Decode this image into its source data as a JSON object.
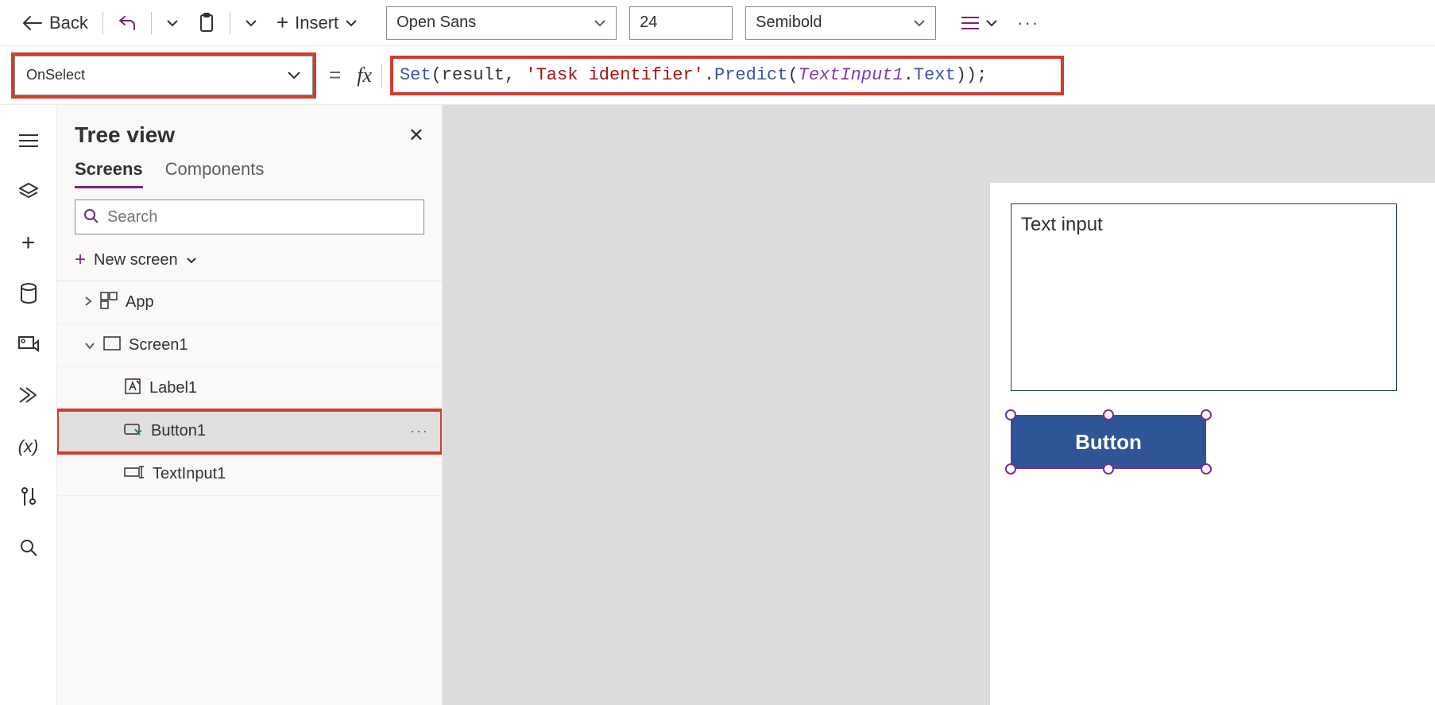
{
  "toolbar": {
    "back_label": "Back",
    "insert_label": "Insert",
    "font": "Open Sans",
    "font_size": "24",
    "font_weight": "Semibold"
  },
  "formula": {
    "property": "OnSelect",
    "tokens": {
      "set": "Set",
      "open_args": "(result, ",
      "str": "'Task identifier'",
      "dot1": ".",
      "predict": "Predict",
      "open2": "(",
      "ident": "TextInput1",
      "dot2": ".",
      "text_prop": "Text",
      "close": "));"
    }
  },
  "tree": {
    "title": "Tree view",
    "tabs": {
      "screens": "Screens",
      "components": "Components"
    },
    "search_placeholder": "Search",
    "new_screen_label": "New screen",
    "items": {
      "app": "App",
      "screen1": "Screen1",
      "label1": "Label1",
      "button1": "Button1",
      "textinput1": "TextInput1"
    }
  },
  "canvas": {
    "textinput_value": "Text input",
    "button_label": "Button"
  },
  "icons": {
    "plus": "+",
    "ellipsis": "···"
  }
}
